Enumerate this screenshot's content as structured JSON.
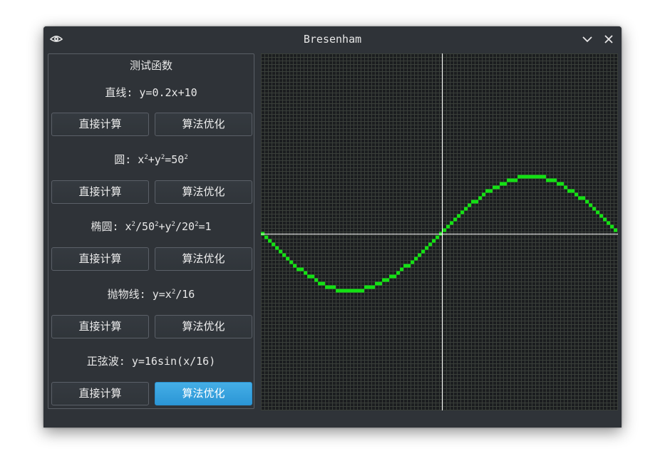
{
  "window": {
    "title": "Bresenham"
  },
  "panel": {
    "heading": "测试函数",
    "line_label": "直线: y=0.2x+10",
    "circle_prefix": "圆: x",
    "circle_mid": "+y",
    "circle_eq": "=50",
    "ellipse_prefix": "椭圆: x",
    "ellipse_a": "/50",
    "ellipse_mid": "+y",
    "ellipse_b": "/20",
    "ellipse_eq": "=1",
    "parabola_prefix": "抛物线: y=x",
    "parabola_suffix": "/16",
    "sine_label": "正弦波: y=16sin(x/16)",
    "square": "2",
    "direct_label": "直接计算",
    "optimized_label": "算法优化"
  },
  "canvas": {
    "grid_color": "#3a3f3a",
    "background": "#1b1d1f",
    "axis_color": "#ffffff",
    "curve_color": "#14e014",
    "active_button_color": "#3aa3e0",
    "active_function": "sine",
    "active_method": "optimized"
  },
  "chart_data": {
    "type": "scatter",
    "function": "y=16sin(x/16)",
    "xlim": [
      -50,
      50
    ],
    "ylim": [
      -50,
      50
    ],
    "amplitude": 16,
    "period_divisor": 16,
    "grid": true
  }
}
